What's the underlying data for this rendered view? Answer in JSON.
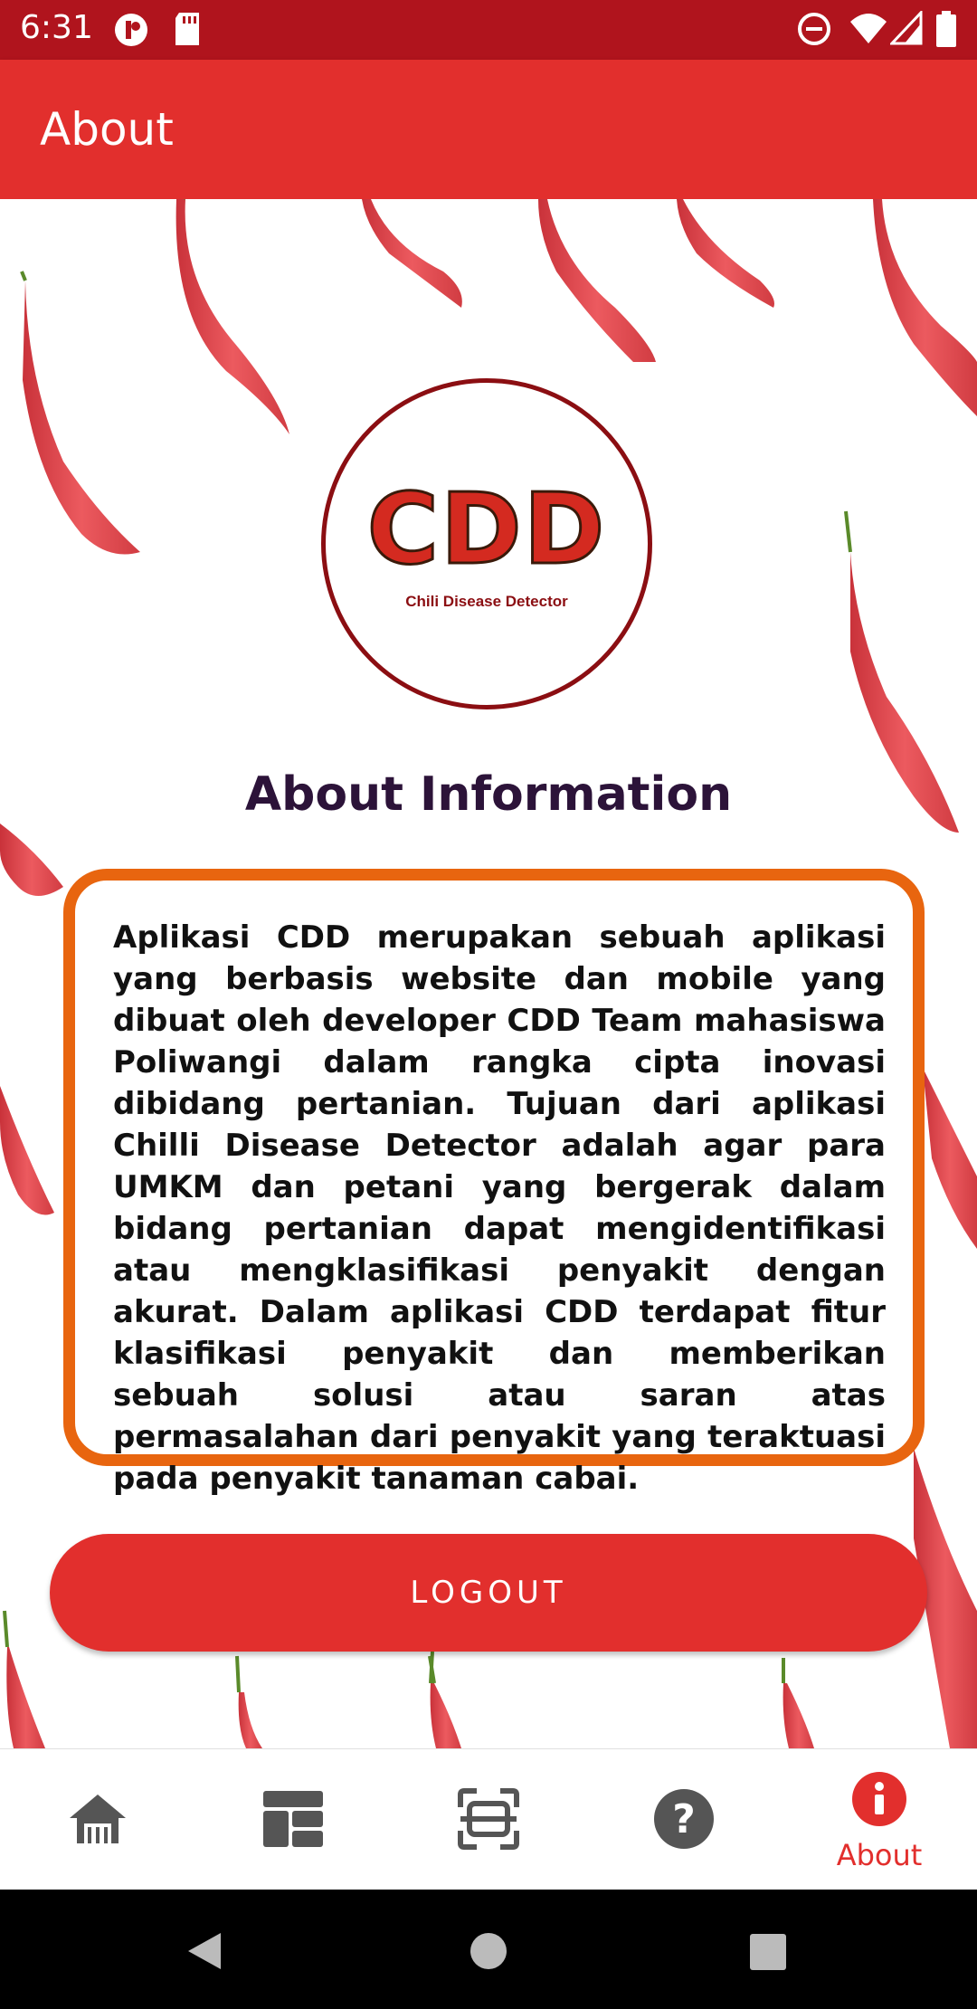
{
  "status_bar": {
    "time": "6:31",
    "icons": [
      "app-notification-icon",
      "sd-card-icon",
      "do-not-disturb-icon",
      "wifi-icon",
      "signal-icon",
      "battery-icon"
    ]
  },
  "app_bar": {
    "title": "About"
  },
  "logo": {
    "text": "CDD",
    "subtitle": "Chili Disease Detector"
  },
  "heading": "About Information",
  "info_text": "Aplikasi CDD merupakan sebuah aplikasi yang berbasis website dan mobile yang dibuat oleh developer CDD Team mahasiswa Poliwangi dalam rangka cipta inovasi dibidang pertanian. Tujuan dari aplikasi Chilli Disease Detector adalah agar para UMKM dan petani yang bergerak dalam bidang pertanian dapat mengidentifikasi atau mengklasifikasi penyakit dengan akurat. Dalam aplikasi CDD terdapat fitur klasifikasi penyakit dan memberikan sebuah solusi atau saran atas permasalahan dari penyakit yang teraktuasi pada penyakit tanaman cabai.",
  "logout_label": "LOGOUT",
  "bottom_nav": {
    "items": [
      {
        "icon": "home-icon",
        "label": ""
      },
      {
        "icon": "dashboard-icon",
        "label": ""
      },
      {
        "icon": "scan-icon",
        "label": ""
      },
      {
        "icon": "help-icon",
        "label": ""
      },
      {
        "icon": "info-icon",
        "label": "About",
        "active": true
      }
    ]
  },
  "colors": {
    "status_bar": "#b0141d",
    "primary": "#e22f2d",
    "card_border": "#e8650f",
    "heading": "#2c1339",
    "nav_inactive": "#555555"
  }
}
